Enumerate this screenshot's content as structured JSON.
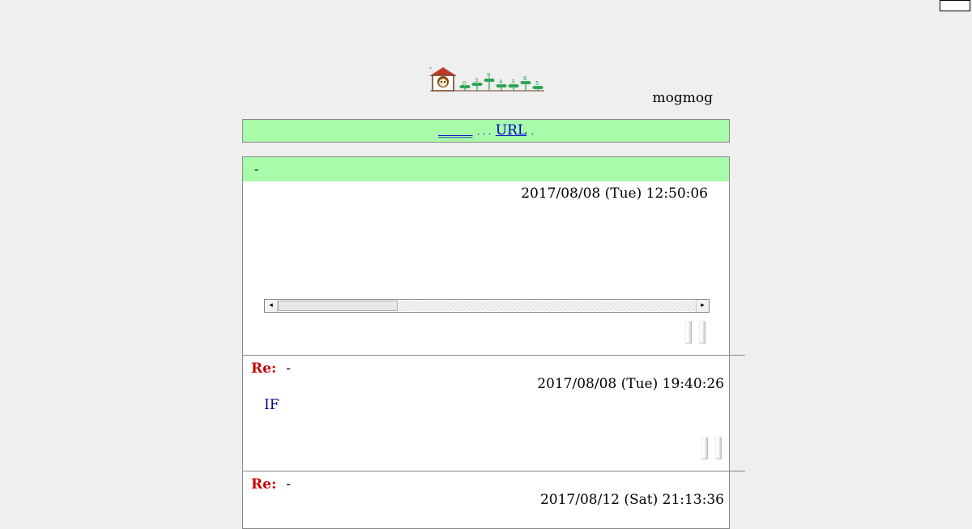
{
  "header": {
    "logo_name": "house-with-sprouts-counter",
    "counter_digits": [
      "0",
      "3",
      "9",
      "4",
      "3",
      "6",
      "5"
    ],
    "owner": "mogmog"
  },
  "menu": {
    "link1": "_____",
    "dots1": ". . .",
    "link2": "URL",
    "dots2": "."
  },
  "thread": {
    "title": "-",
    "posted": "2017/08/08 (Tue) 12:50:06",
    "replies": [
      {
        "label": "Re:",
        "title": "-",
        "posted": "2017/08/08 (Tue) 19:40:26",
        "body": "IF"
      },
      {
        "label": "Re:",
        "title": "-",
        "posted": "2017/08/12 (Sat) 21:13:36",
        "body": ""
      }
    ]
  },
  "colors": {
    "header_bg": "#a8fba8",
    "page_bg": "#efefef",
    "re_label": "#cc0000",
    "link": "#0000cc"
  }
}
